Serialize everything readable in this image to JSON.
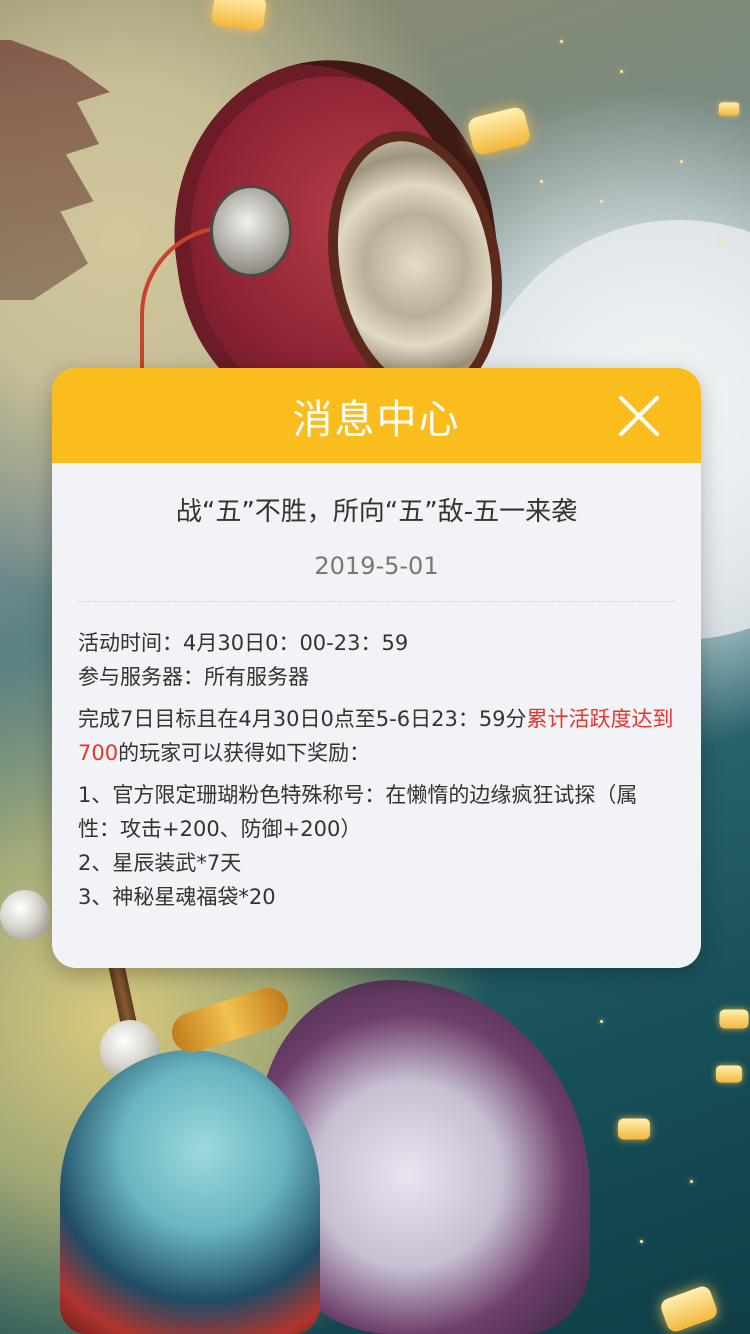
{
  "modal": {
    "title": "消息中心",
    "close_icon": "close-icon",
    "header_color": "#fbbd1e"
  },
  "notice": {
    "title": "战“五”不胜，所向“五”敌-五一来袭",
    "date": "2019-5-01",
    "activity_time": "活动时间：4月30日0：00-23：59",
    "servers": "参与服务器：所有服务器",
    "condition_prefix": "完成7日目标且在4月30日0点至5-6日23：59分",
    "condition_highlight": "累计活跃度达到700",
    "condition_suffix": "的玩家可以获得如下奖励：",
    "rewards": [
      "1、官方限定珊瑚粉色特殊称号：在懒惰的边缘疯狂试探（属性：攻击+200、防御+200）",
      "2、星辰装武*7天",
      "3、神秘星魂福袋*20"
    ],
    "highlight_color": "#e8352e"
  }
}
